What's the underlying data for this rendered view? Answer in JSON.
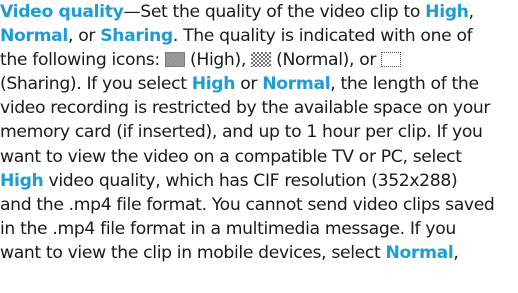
{
  "paragraph": {
    "l1": {
      "kw1": "Video quality",
      "t1": "—Set the quality of the video clip to ",
      "kw2": "High",
      "t2": ","
    },
    "l2": {
      "kw1": "Normal",
      "t1": ", or ",
      "kw2": "Sharing",
      "t2": ". The quality is indicated with one of"
    },
    "l3": {
      "t1": "the following icons: ",
      "t2": " (High), ",
      "t3": " (Normal), or "
    },
    "l4": {
      "t1": "(Sharing). If you select ",
      "kw1": "High",
      "t2": " or ",
      "kw2": "Normal",
      "t3": ", the length of the"
    },
    "l5": {
      "t1": "video recording is restricted by the available space on your"
    },
    "l6": {
      "t1": "memory card (if inserted), and up to 1 hour per clip. If you"
    },
    "l7": {
      "t1": "want to view the video on a compatible TV or PC, select"
    },
    "l8": {
      "kw1": "High",
      "t1": " video quality, which has CIF resolution (352x288)"
    },
    "l9": {
      "t1": "and the .mp4 file format. You cannot send video clips saved"
    },
    "l10": {
      "t1": "in the .mp4 file format in a multimedia message. If you"
    },
    "l11": {
      "t1": "want to view the clip in mobile devices, select ",
      "kw1": "Normal",
      "t2": ","
    }
  },
  "icons": {
    "high": "high-quality-icon",
    "normal": "normal-quality-icon",
    "sharing": "sharing-quality-icon"
  },
  "colors": {
    "keyword": "#1f9bd6",
    "text": "#1a1a1a"
  }
}
